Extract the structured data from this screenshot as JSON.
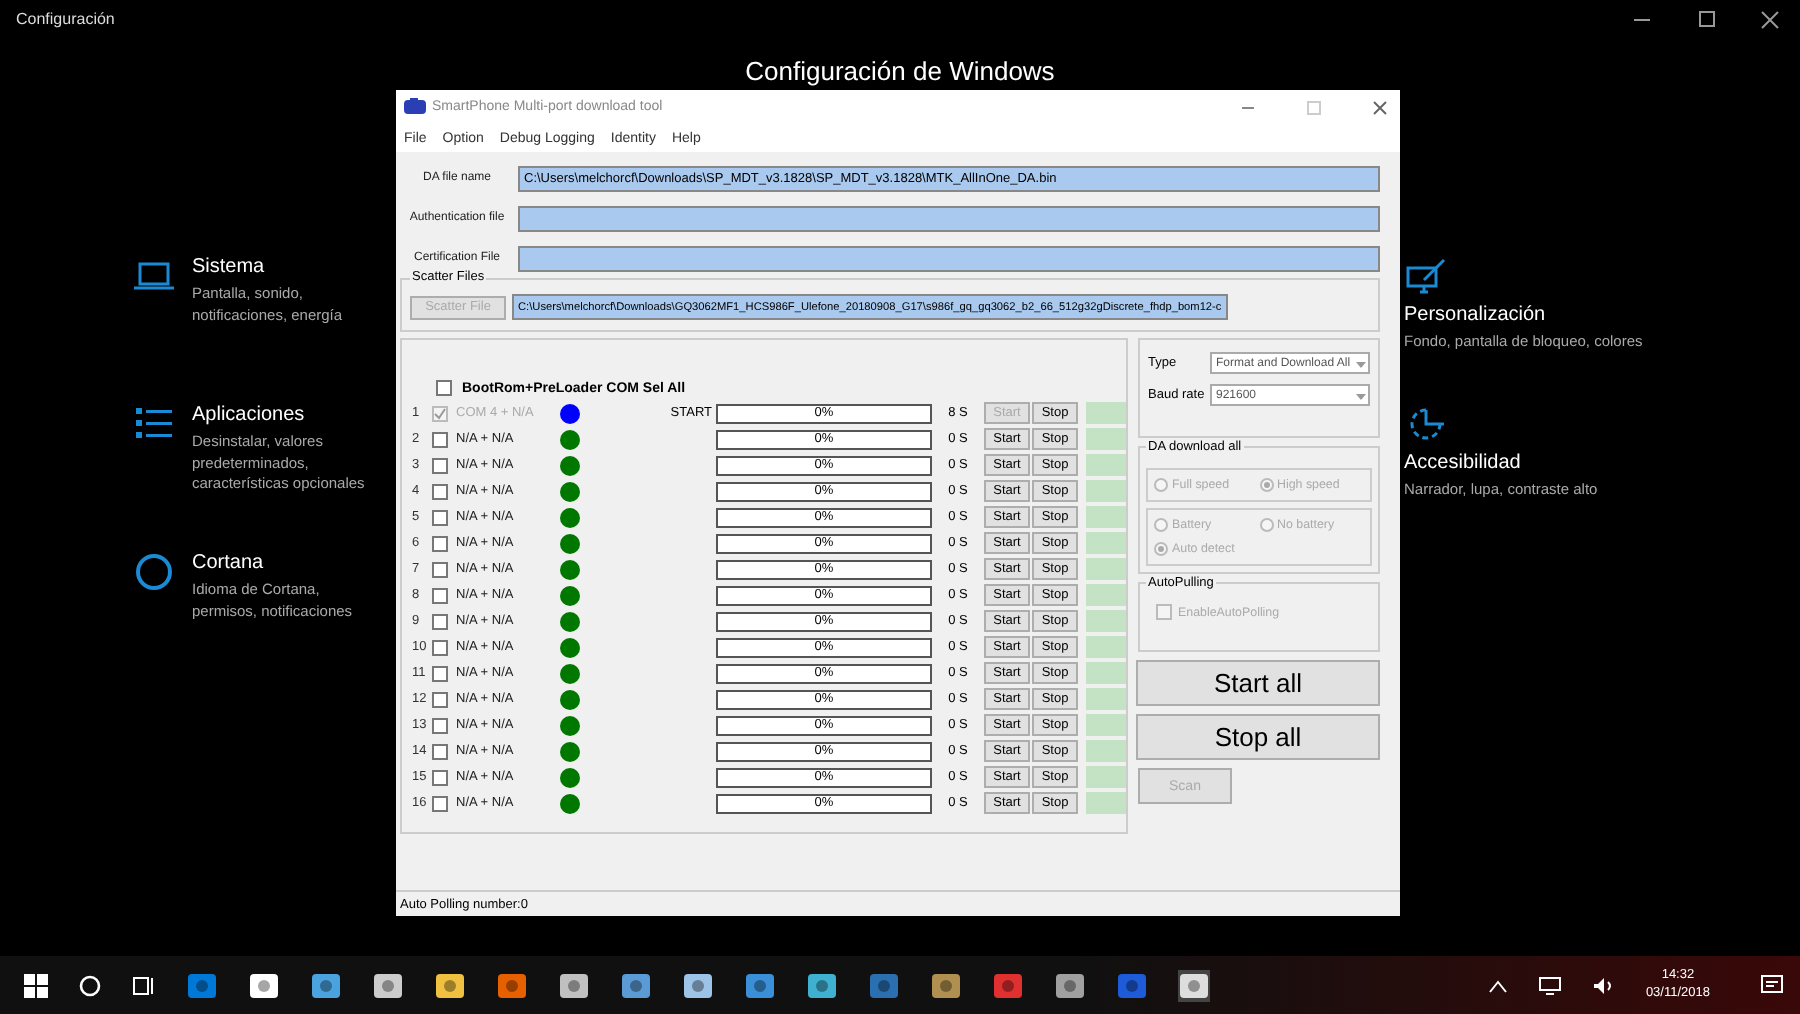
{
  "settings_window": {
    "title": "Configuración",
    "heading": "Configuración de Windows"
  },
  "categories_left": [
    {
      "kind": "laptop",
      "title": "Sistema",
      "description": "Pantalla, sonido, notificaciones, energía"
    },
    {
      "kind": "list",
      "title": "Aplicaciones",
      "description": "Desinstalar, valores predeterminados, características opcionales"
    },
    {
      "kind": "ring",
      "title": "Cortana",
      "description": "Idioma de Cortana, permisos, notificaciones"
    }
  ],
  "categories_right": [
    {
      "kind": "brush",
      "title": "Personalización",
      "description": "Fondo, pantalla de bloqueo, colores"
    },
    {
      "kind": "timer",
      "title": "Accesibilidad",
      "description": "Narrador, lupa, contraste alto"
    }
  ],
  "dialog": {
    "title": "SmartPhone Multi-port download tool",
    "menu": [
      "File",
      "Option",
      "Debug Logging",
      "Identity",
      "Help"
    ],
    "fields": [
      {
        "label": "DA file name",
        "value": "C:\\Users\\melchorcf\\Downloads\\SP_MDT_v3.1828\\SP_MDT_v3.1828\\MTK_AllInOne_DA.bin"
      },
      {
        "label": "Authentication file"
      },
      {
        "label": "Certification File"
      }
    ],
    "scatter": {
      "group": "Scatter Files",
      "button": "Scatter File",
      "value": "C:\\Users\\melchorcf\\Downloads\\GQ3062MF1_HCS986F_Ulefone_20180908_G17\\s986f_gq_gq3062_b2_66_512g32gDiscrete_fhdp_bom12-c"
    },
    "sel_all": {
      "label": "BootRom+PreLoader COM Sel All",
      "checked": false
    },
    "ports": [
      {
        "num": "1",
        "checked": true,
        "disabled": true,
        "port": "COM 4 + N/A",
        "color": "#0000ff",
        "status": "START",
        "progress": "0%",
        "level": 0,
        "time": "8 S",
        "start": "Start",
        "start_disabled": true,
        "stop": "Stop"
      },
      {
        "num": "2",
        "checked": false,
        "disabled": false,
        "port": "N/A + N/A",
        "color": "#007800",
        "progress": "0%",
        "level": 0,
        "time": "0 S",
        "start": "Start",
        "start_disabled": false,
        "stop": "Stop"
      },
      {
        "num": "3",
        "checked": false,
        "disabled": false,
        "port": "N/A + N/A",
        "color": "#007800",
        "progress": "0%",
        "level": 0,
        "time": "0 S",
        "start": "Start",
        "start_disabled": false,
        "stop": "Stop"
      },
      {
        "num": "4",
        "checked": false,
        "disabled": false,
        "port": "N/A + N/A",
        "color": "#007800",
        "progress": "0%",
        "level": 0,
        "time": "0 S",
        "start": "Start",
        "start_disabled": false,
        "stop": "Stop"
      },
      {
        "num": "5",
        "checked": false,
        "disabled": false,
        "port": "N/A + N/A",
        "color": "#007800",
        "progress": "0%",
        "level": 0,
        "time": "0 S",
        "start": "Start",
        "start_disabled": false,
        "stop": "Stop"
      },
      {
        "num": "6",
        "checked": false,
        "disabled": false,
        "port": "N/A + N/A",
        "color": "#007800",
        "progress": "0%",
        "level": 0,
        "time": "0 S",
        "start": "Start",
        "start_disabled": false,
        "stop": "Stop"
      },
      {
        "num": "7",
        "checked": false,
        "disabled": false,
        "port": "N/A + N/A",
        "color": "#007800",
        "progress": "0%",
        "level": 0,
        "time": "0 S",
        "start": "Start",
        "start_disabled": false,
        "stop": "Stop"
      },
      {
        "num": "8",
        "checked": false,
        "disabled": false,
        "port": "N/A + N/A",
        "color": "#007800",
        "progress": "0%",
        "level": 0,
        "time": "0 S",
        "start": "Start",
        "start_disabled": false,
        "stop": "Stop"
      },
      {
        "num": "9",
        "checked": false,
        "disabled": false,
        "port": "N/A + N/A",
        "color": "#007800",
        "progress": "0%",
        "level": 0,
        "time": "0 S",
        "start": "Start",
        "start_disabled": false,
        "stop": "Stop"
      },
      {
        "num": "10",
        "checked": false,
        "disabled": false,
        "port": "N/A + N/A",
        "color": "#007800",
        "progress": "0%",
        "level": 0,
        "time": "0 S",
        "start": "Start",
        "start_disabled": false,
        "stop": "Stop"
      },
      {
        "num": "11",
        "checked": false,
        "disabled": false,
        "port": "N/A + N/A",
        "color": "#007800",
        "progress": "0%",
        "level": 0,
        "time": "0 S",
        "start": "Start",
        "start_disabled": false,
        "stop": "Stop"
      },
      {
        "num": "12",
        "checked": false,
        "disabled": false,
        "port": "N/A + N/A",
        "color": "#007800",
        "progress": "0%",
        "level": 0,
        "time": "0 S",
        "start": "Start",
        "start_disabled": false,
        "stop": "Stop"
      },
      {
        "num": "13",
        "checked": false,
        "disabled": false,
        "port": "N/A + N/A",
        "color": "#007800",
        "progress": "0%",
        "level": 0,
        "time": "0 S",
        "start": "Start",
        "start_disabled": false,
        "stop": "Stop"
      },
      {
        "num": "14",
        "checked": false,
        "disabled": false,
        "port": "N/A + N/A",
        "color": "#007800",
        "progress": "0%",
        "level": 0,
        "time": "0 S",
        "start": "Start",
        "start_disabled": false,
        "stop": "Stop"
      },
      {
        "num": "15",
        "checked": false,
        "disabled": false,
        "port": "N/A + N/A",
        "color": "#007800",
        "progress": "0%",
        "level": 0,
        "time": "0 S",
        "start": "Start",
        "start_disabled": false,
        "stop": "Stop"
      },
      {
        "num": "16",
        "checked": false,
        "disabled": false,
        "port": "N/A + N/A",
        "color": "#007800",
        "progress": "0%",
        "level": 0,
        "time": "0 S",
        "start": "Start",
        "start_disabled": false,
        "stop": "Stop"
      }
    ],
    "type": {
      "label": "Type",
      "value": "Format and Download All"
    },
    "baud": {
      "label": "Baud rate",
      "value": "921600"
    },
    "da_group": {
      "label": "DA download all",
      "speed": [
        {
          "label": "Full speed",
          "selected": false
        },
        {
          "label": "High speed",
          "selected": true
        }
      ],
      "battery": [
        {
          "label": "Battery",
          "selected": false
        },
        {
          "label": "No battery",
          "selected": false
        },
        {
          "label": "Auto detect",
          "selected": true
        }
      ]
    },
    "autopolling": {
      "group": "AutoPulling",
      "label": "EnableAutoPolling",
      "checked": false
    },
    "start_all": "Start all",
    "stop_all": "Stop all",
    "scan": {
      "label": "Scan",
      "disabled": true
    },
    "status": "Auto Polling number:0"
  },
  "taskbar": {
    "time": "14:32",
    "date": "03/11/2018"
  }
}
